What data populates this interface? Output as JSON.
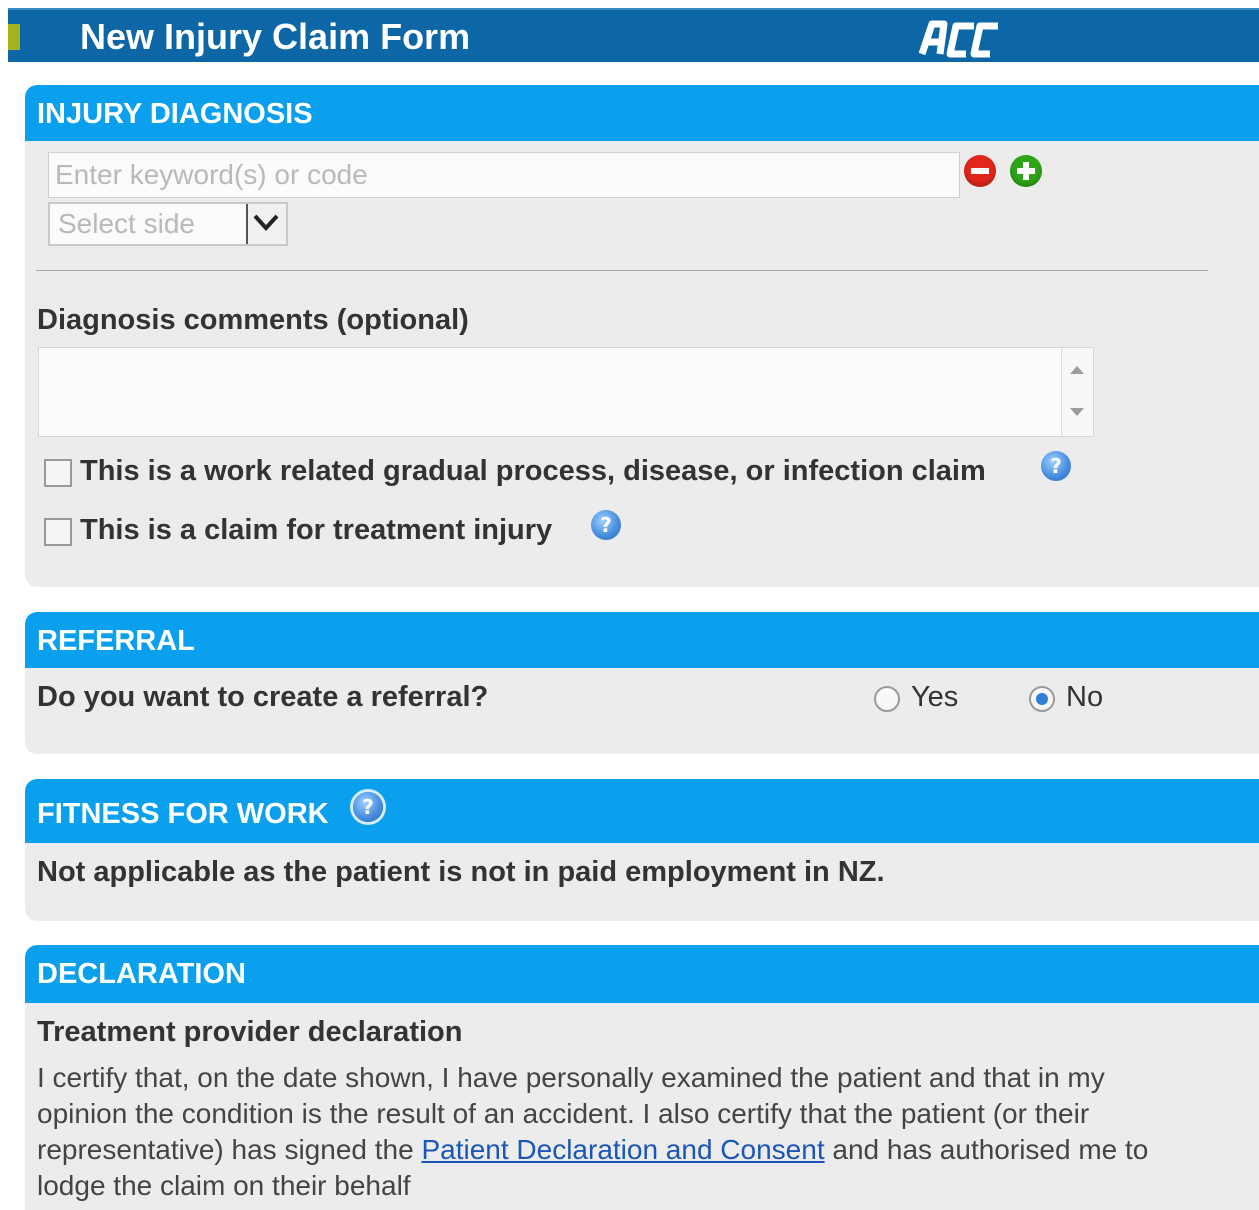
{
  "header": {
    "title": "New Injury Claim Form",
    "logo_text": "ACC"
  },
  "injury_diagnosis": {
    "heading": "INJURY DIAGNOSIS",
    "keyword_input": {
      "value": "",
      "placeholder": "Enter keyword(s) or code"
    },
    "side_select": {
      "selected": "Select side"
    },
    "comments_label": "Diagnosis comments (optional)",
    "comments_value": "",
    "checkboxes": [
      {
        "label": "This is a work related gradual process, disease, or infection claim",
        "checked": false
      },
      {
        "label": "This is a claim for treatment injury",
        "checked": false
      }
    ]
  },
  "referral": {
    "heading": "REFERRAL",
    "question": "Do you want to create a referral?",
    "options": [
      {
        "label": "Yes",
        "selected": false
      },
      {
        "label": "No",
        "selected": true
      }
    ]
  },
  "fitness_for_work": {
    "heading": "FITNESS FOR WORK",
    "message": "Not applicable as the patient is not in paid employment in NZ."
  },
  "declaration": {
    "heading": "DECLARATION",
    "subheading": "Treatment provider declaration",
    "line1": "I certify that, on the date shown, I have personally examined the patient and that in my",
    "line2": "opinion the condition is the result of an accident. I also certify that the patient (or their",
    "line3_before": "representative) has signed the ",
    "link": "Patient Declaration and Consent",
    "line3_after": " and has authorised me to",
    "line4": "lodge the claim on their behalf"
  },
  "colors": {
    "title_bar": "#0d66a6",
    "section_header": "#0aa0ee",
    "panel_bg": "#ececec",
    "link": "#1a56b8"
  },
  "icons": {
    "remove": "remove-circle-icon",
    "add": "add-circle-icon",
    "help": "help-icon",
    "dropdown": "chevron-down-icon"
  }
}
